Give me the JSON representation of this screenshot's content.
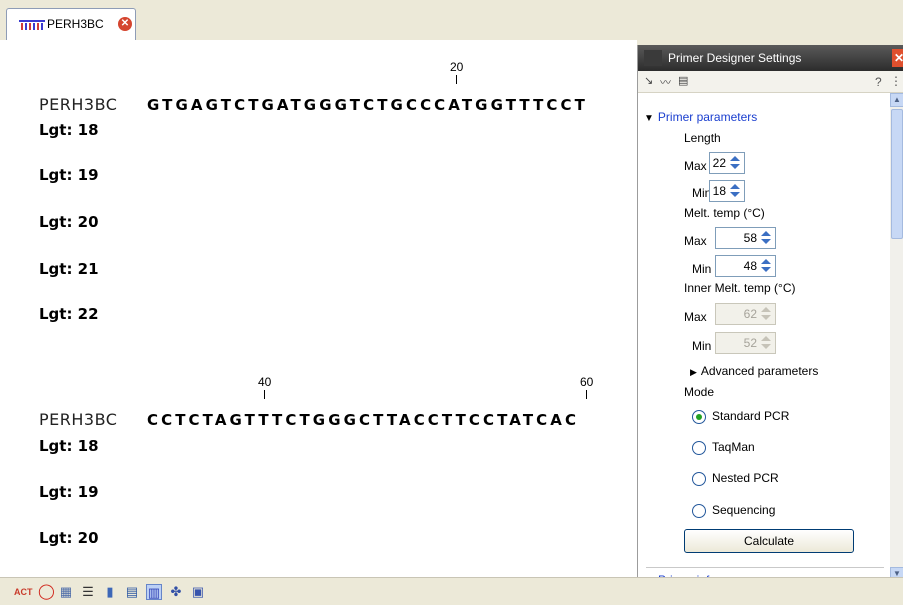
{
  "tab": {
    "label": "PERH3BC",
    "icon": "sequence-icon",
    "close_icon": "close-icon"
  },
  "sequence_view": {
    "blocks": [
      {
        "ruler": [
          {
            "label": "20"
          }
        ],
        "name": "PERH3BC",
        "sequence": "GTGAGTCTGATGGGTCTGCCCATGGTTTCCT",
        "rows": [
          "Lgt: 18",
          "Lgt: 19",
          "Lgt: 20",
          "Lgt: 21",
          "Lgt: 22"
        ]
      },
      {
        "ruler": [
          {
            "label": "40"
          },
          {
            "label": "60"
          }
        ],
        "name": "PERH3BC",
        "sequence": "CCTCTAGTTTCTGGGCTTACCTTCCTATCAC",
        "rows": [
          "Lgt: 18",
          "Lgt: 19",
          "Lgt: 20"
        ]
      }
    ]
  },
  "panel": {
    "title": "Primer Designer Settings",
    "help": "?",
    "section_title": "Primer parameters",
    "length_label": "Length",
    "length_max_label": "Max",
    "length_max": "22",
    "length_min_label": "Min",
    "length_min": "18",
    "melt_label": "Melt. temp (°C)",
    "melt_max_label": "Max",
    "melt_max": "58",
    "melt_min_label": "Min",
    "melt_min": "48",
    "inner_label": "Inner Melt. temp (°C)",
    "inner_max_label": "Max",
    "inner_max": "62",
    "inner_min_label": "Min",
    "inner_min": "52",
    "advanced": "Advanced parameters",
    "mode_label": "Mode",
    "modes": [
      {
        "label": "Standard PCR",
        "selected": true
      },
      {
        "label": "TaqMan",
        "selected": false
      },
      {
        "label": "Nested PCR",
        "selected": false
      },
      {
        "label": "Sequencing",
        "selected": false
      }
    ],
    "calculate": "Calculate",
    "next_section": "Primer info"
  },
  "bottom_toolbar": {
    "icons": [
      "dna-view-icon",
      "circular-view-icon",
      "graph-icon",
      "list-icon",
      "book-icon",
      "text-view-icon",
      "sequence-view-icon",
      "primer-icon",
      "restriction-icon"
    ]
  },
  "colors": {
    "accent": "#1a3ecf",
    "radio_selected": "#21a121",
    "panel_title_bg": "#3a3a3a",
    "close_red": "#d5452f"
  }
}
